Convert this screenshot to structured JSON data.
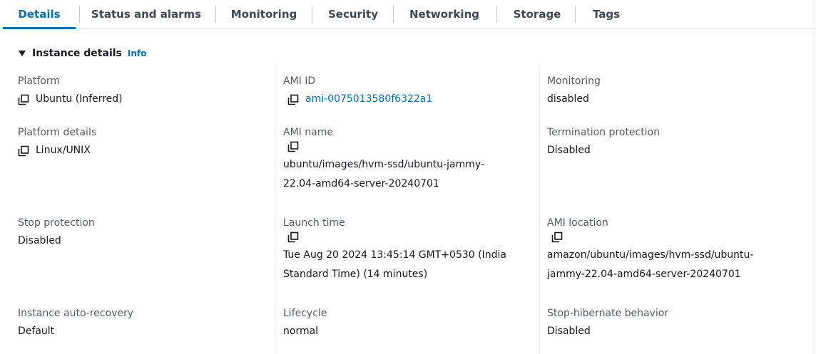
{
  "tabs": [
    {
      "label": "Details",
      "active": true
    },
    {
      "label": "Status and alarms",
      "active": false
    },
    {
      "label": "Monitoring",
      "active": false
    },
    {
      "label": "Security",
      "active": false
    },
    {
      "label": "Networking",
      "active": false
    },
    {
      "label": "Storage",
      "active": false
    },
    {
      "label": "Tags",
      "active": false
    }
  ],
  "section": {
    "title": "Instance details",
    "info_link": "Info"
  },
  "fields": {
    "platform": {
      "label": "Platform",
      "value": "Ubuntu (Inferred)"
    },
    "ami_id": {
      "label": "AMI ID",
      "value": "ami-0075013580f6322a1"
    },
    "monitoring": {
      "label": "Monitoring",
      "value": "disabled"
    },
    "platform_details": {
      "label": "Platform details",
      "value": "Linux/UNIX"
    },
    "ami_name": {
      "label": "AMI name",
      "value_line1": "ubuntu/images/hvm-ssd/ubuntu-jammy-",
      "value_line2": "22.04-amd64-server-20240701"
    },
    "termination_protection": {
      "label": "Termination protection",
      "value": "Disabled"
    },
    "stop_protection": {
      "label": "Stop protection",
      "value": "Disabled"
    },
    "launch_time": {
      "label": "Launch time",
      "value_line1": "Tue Aug 20 2024 13:45:14 GMT+0530 (India",
      "value_line2": "Standard Time) (14 minutes)"
    },
    "ami_location": {
      "label": "AMI location",
      "value_line1": "amazon/ubuntu/images/hvm-ssd/ubuntu-",
      "value_line2": "jammy-22.04-amd64-server-20240701"
    },
    "auto_recovery": {
      "label": "Instance auto-recovery",
      "value": "Default"
    },
    "lifecycle": {
      "label": "Lifecycle",
      "value": "normal"
    },
    "stop_hibernate": {
      "label": "Stop-hibernate behavior",
      "value": "Disabled"
    }
  },
  "colors": {
    "accent": "#0073bb",
    "label": "#545b64",
    "text": "#16191f"
  },
  "icons": {
    "copy": "copy-icon",
    "caret": "caret-down-icon"
  }
}
